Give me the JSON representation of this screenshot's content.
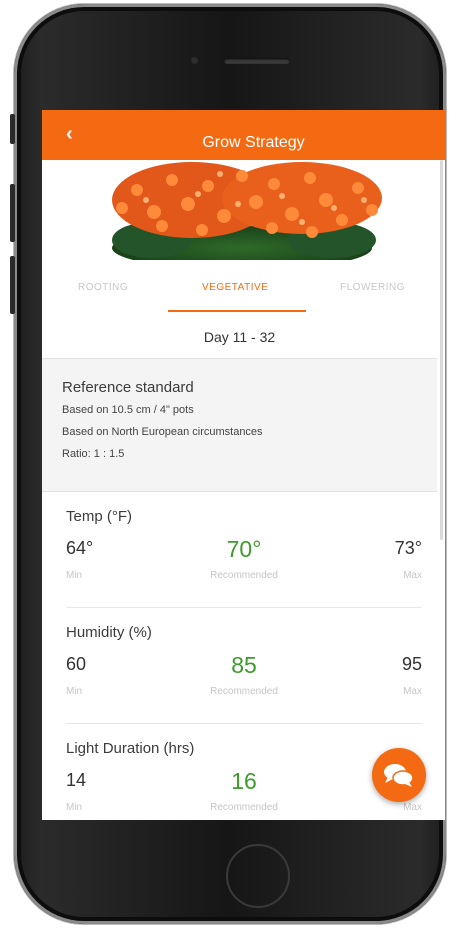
{
  "header": {
    "back_label": "‹",
    "title": "Grow Strategy"
  },
  "colors": {
    "accent": "#f36a12",
    "recommended": "#3e9b2c"
  },
  "tabs": [
    {
      "label": "ROOTING"
    },
    {
      "label": "VEGETATIVE"
    },
    {
      "label": "FLOWERING"
    }
  ],
  "day_range": "Day 11 - 32",
  "reference": {
    "title": "Reference standard",
    "lines": [
      "Based on 10.5 cm / 4\" pots",
      "Based on North European circumstances",
      "Ratio: 1 : 1.5"
    ]
  },
  "metrics": [
    {
      "label": "Temp (°F)",
      "min": "64°",
      "recommended": "70°",
      "max": "73°",
      "min_caption": "Min",
      "recommended_caption": "Recommended",
      "max_caption": "Max"
    },
    {
      "label": "Humidity (%)",
      "min": "60",
      "recommended": "85",
      "max": "95",
      "min_caption": "Min",
      "recommended_caption": "Recommended",
      "max_caption": "Max"
    },
    {
      "label": "Light Duration (hrs)",
      "min": "14",
      "recommended": "16",
      "max": "",
      "min_caption": "Min",
      "recommended_caption": "Recommended",
      "max_caption": "Max"
    }
  ],
  "icons": {
    "back": "chevron-left-icon",
    "chat": "chat-bubble-icon"
  }
}
